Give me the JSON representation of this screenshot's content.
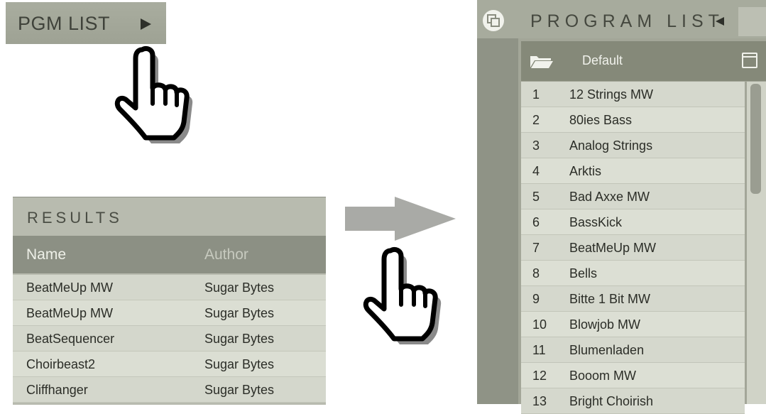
{
  "pgm_button": {
    "label": "PGM LIST"
  },
  "results": {
    "title": "RESULTS",
    "columns": [
      "Name",
      "Author"
    ],
    "rows": [
      [
        "BeatMeUp  MW",
        "Sugar Bytes"
      ],
      [
        "BeatMeUp  MW",
        "Sugar Bytes"
      ],
      [
        "BeatSequencer",
        "Sugar Bytes"
      ],
      [
        "Choirbeast2",
        "Sugar Bytes"
      ],
      [
        "Cliffhanger",
        "Sugar Bytes"
      ]
    ]
  },
  "program_list": {
    "title": "PROGRAM LIST",
    "folder": "Default",
    "items": [
      {
        "num": "1",
        "name": "12 Strings  MW"
      },
      {
        "num": "2",
        "name": "80ies Bass"
      },
      {
        "num": "3",
        "name": "Analog Strings"
      },
      {
        "num": "4",
        "name": "Arktis"
      },
      {
        "num": "5",
        "name": "Bad Axxe  MW"
      },
      {
        "num": "6",
        "name": "BassKick"
      },
      {
        "num": "7",
        "name": "BeatMeUp  MW"
      },
      {
        "num": "8",
        "name": "Bells"
      },
      {
        "num": "9",
        "name": "Bitte 1 Bit  MW"
      },
      {
        "num": "10",
        "name": "Blowjob  MW"
      },
      {
        "num": "11",
        "name": "Blumenladen"
      },
      {
        "num": "12",
        "name": "Booom  MW"
      },
      {
        "num": "13",
        "name": "Bright Choirish"
      }
    ]
  },
  "icons": {
    "play": "play-triangle-icon",
    "back": "back-triangle-icon",
    "hand": "pointing-hand-icon",
    "arrow": "right-arrow-icon",
    "folder": "folder-icon",
    "save": "save-icon",
    "window": "window-icon"
  },
  "colors": {
    "panel": "#a3a698",
    "header": "#8c9084",
    "row": "#d5d8cd",
    "text": "#2b2d27"
  }
}
